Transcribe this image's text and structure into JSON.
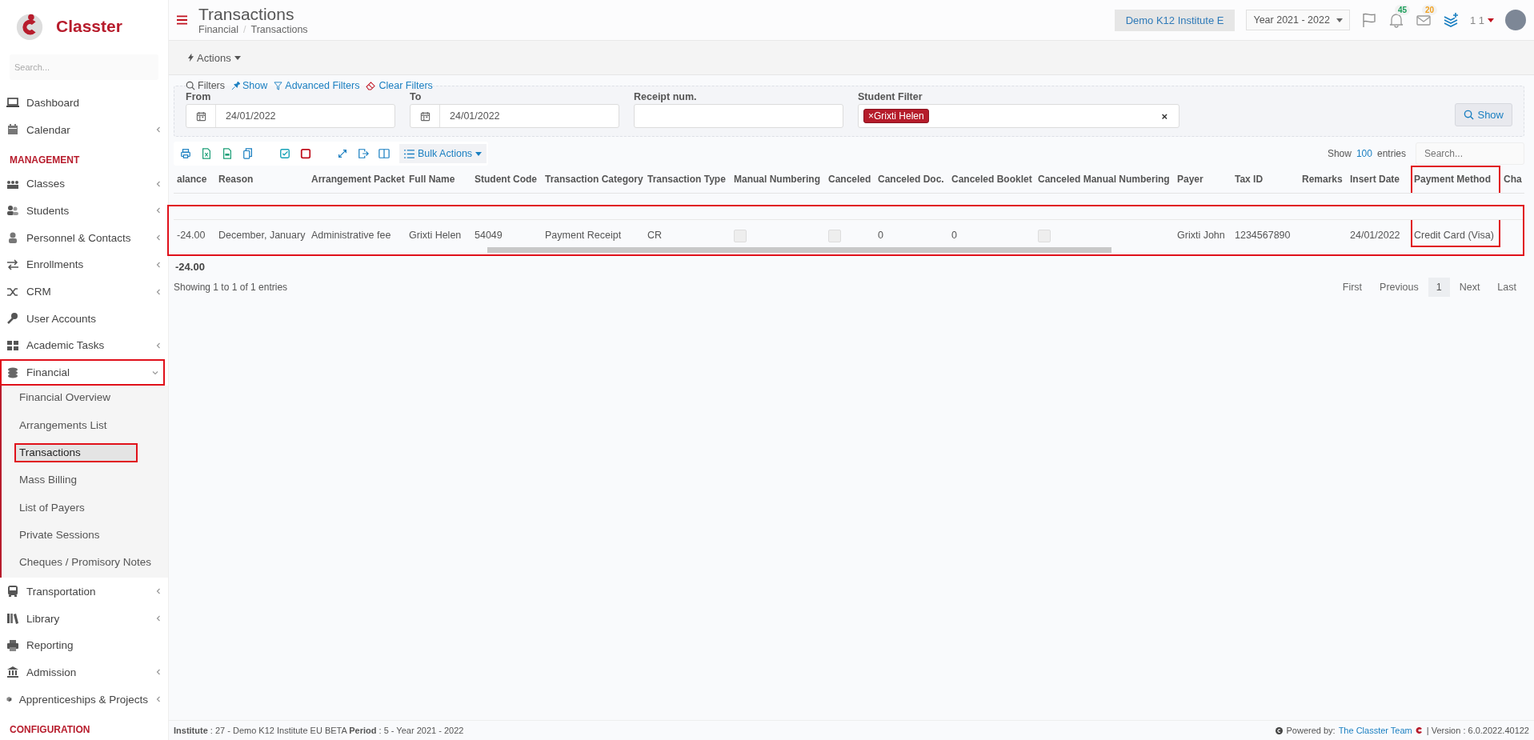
{
  "brand": {
    "name": "Classter"
  },
  "sidebar": {
    "search_placeholder": "Search...",
    "entries": [
      {
        "kind": "item",
        "label": "Dashboard",
        "expandable": false,
        "expanded": false,
        "highlighted": false
      },
      {
        "kind": "item",
        "label": "Calendar",
        "expandable": true,
        "expanded": false,
        "highlighted": false
      },
      {
        "kind": "section",
        "label": "MANAGEMENT"
      },
      {
        "kind": "item",
        "label": "Classes",
        "expandable": true,
        "expanded": false,
        "highlighted": false
      },
      {
        "kind": "item",
        "label": "Students",
        "expandable": true,
        "expanded": false,
        "highlighted": false
      },
      {
        "kind": "item",
        "label": "Personnel & Contacts",
        "expandable": true,
        "expanded": false,
        "highlighted": false
      },
      {
        "kind": "item",
        "label": "Enrollments",
        "expandable": true,
        "expanded": false,
        "highlighted": false
      },
      {
        "kind": "item",
        "label": "CRM",
        "expandable": true,
        "expanded": false,
        "highlighted": false
      },
      {
        "kind": "item",
        "label": "User Accounts",
        "expandable": false,
        "expanded": false,
        "highlighted": false
      },
      {
        "kind": "item",
        "label": "Academic Tasks",
        "expandable": true,
        "expanded": false,
        "highlighted": false
      },
      {
        "kind": "item",
        "label": "Financial",
        "expandable": true,
        "expanded": true,
        "highlighted": true,
        "children": [
          {
            "label": "Financial Overview",
            "selected": false,
            "highlighted": false
          },
          {
            "label": "Arrangements List",
            "selected": false,
            "highlighted": false
          },
          {
            "label": "Transactions",
            "selected": true,
            "highlighted": true
          },
          {
            "label": "Mass Billing",
            "selected": false,
            "highlighted": false
          },
          {
            "label": "List of Payers",
            "selected": false,
            "highlighted": false
          },
          {
            "label": "Private Sessions",
            "selected": false,
            "highlighted": false
          },
          {
            "label": "Cheques / Promisory Notes",
            "selected": false,
            "highlighted": false
          }
        ]
      },
      {
        "kind": "item",
        "label": "Transportation",
        "expandable": true,
        "expanded": false,
        "highlighted": false
      },
      {
        "kind": "item",
        "label": "Library",
        "expandable": true,
        "expanded": false,
        "highlighted": false
      },
      {
        "kind": "item",
        "label": "Reporting",
        "expandable": false,
        "expanded": false,
        "highlighted": false
      },
      {
        "kind": "item",
        "label": "Admission",
        "expandable": true,
        "expanded": false,
        "highlighted": false
      },
      {
        "kind": "item",
        "label": "Apprenticeships & Projects",
        "expandable": true,
        "expanded": false,
        "highlighted": false
      },
      {
        "kind": "section",
        "label": "CONFIGURATION"
      }
    ]
  },
  "header": {
    "title": "Transactions",
    "breadcrumb": [
      "Financial",
      "Transactions"
    ],
    "breadcrumb_separator": "/",
    "institute": "Demo K12 Institute E",
    "year": "Year 2021 - 2022",
    "notifications": "45",
    "messages": "20",
    "user": "1 1"
  },
  "actions_menu": "Actions",
  "filters": {
    "legend": "Filters",
    "links": [
      {
        "label": "Show"
      },
      {
        "label": "Advanced Filters"
      },
      {
        "label": "Clear Filters"
      }
    ],
    "from": {
      "label": "From",
      "value": "24/01/2022"
    },
    "to": {
      "label": "To",
      "value": "24/01/2022"
    },
    "receipt": {
      "label": "Receipt num."
    },
    "student_filter": {
      "label": "Student Filter",
      "tags": [
        {
          "remove": "×",
          "label": "Grixti Helen"
        }
      ],
      "clear": "×"
    },
    "show_button": "Show"
  },
  "toolbar": {
    "bulk_actions": "Bulk Actions",
    "page_length": {
      "prefix": "Show",
      "value": "100",
      "suffix": "entries"
    },
    "search_placeholder": "Search..."
  },
  "table": {
    "columns": [
      {
        "label": "alance",
        "highlighted": false
      },
      {
        "label": "Reason",
        "highlighted": false
      },
      {
        "label": "Arrangement Packet",
        "highlighted": false
      },
      {
        "label": "Full Name",
        "highlighted": false
      },
      {
        "label": "Student Code",
        "highlighted": false
      },
      {
        "label": "Transaction Category",
        "highlighted": false
      },
      {
        "label": "Transaction Type",
        "highlighted": false
      },
      {
        "label": "Manual Numbering",
        "highlighted": false
      },
      {
        "label": "Canceled",
        "highlighted": false
      },
      {
        "label": "Canceled Doc.",
        "highlighted": false
      },
      {
        "label": "Canceled Booklet",
        "highlighted": false
      },
      {
        "label": "Canceled Manual Numbering",
        "highlighted": false
      },
      {
        "label": "Payer",
        "highlighted": false
      },
      {
        "label": "Tax ID",
        "highlighted": false
      },
      {
        "label": "Remarks",
        "highlighted": false
      },
      {
        "label": "Insert Date",
        "highlighted": false
      },
      {
        "label": "Payment Method",
        "highlighted": true
      },
      {
        "label": "Cha",
        "highlighted": false
      }
    ],
    "rows": [
      {
        "highlighted": true,
        "cells": [
          {
            "kind": "text",
            "text": "-24.00"
          },
          {
            "kind": "text",
            "text": "December, January"
          },
          {
            "kind": "text",
            "text": "Administrative fee"
          },
          {
            "kind": "text",
            "text": "Grixti Helen"
          },
          {
            "kind": "text",
            "text": "54049"
          },
          {
            "kind": "text",
            "text": "Payment Receipt"
          },
          {
            "kind": "text",
            "text": "CR"
          },
          {
            "kind": "checkbox",
            "checked": false
          },
          {
            "kind": "checkbox",
            "checked": false
          },
          {
            "kind": "text",
            "text": "0"
          },
          {
            "kind": "text",
            "text": "0"
          },
          {
            "kind": "checkbox",
            "checked": false
          },
          {
            "kind": "text",
            "text": "Grixti John"
          },
          {
            "kind": "text",
            "text": "1234567890"
          },
          {
            "kind": "empty"
          },
          {
            "kind": "text",
            "text": "24/01/2022"
          },
          {
            "kind": "text",
            "text": "Credit Card (Visa)"
          },
          {
            "kind": "empty"
          }
        ]
      }
    ],
    "total": "-24.00"
  },
  "info": "Showing 1 to 1 of 1 entries",
  "pagination": [
    {
      "label": "First",
      "selected": false
    },
    {
      "label": "Previous",
      "selected": false
    },
    {
      "label": "1",
      "selected": true
    },
    {
      "label": "Next",
      "selected": false
    },
    {
      "label": "Last",
      "selected": false
    }
  ],
  "footer": {
    "left": "**Institute** : 27 - Demo K12 Institute EU BETA **Period** : 5 - Year 2021 - 2022",
    "powered": "Powered by:",
    "team": "The Classter Team",
    "version": "| Version : 6.0.2022.40122"
  }
}
